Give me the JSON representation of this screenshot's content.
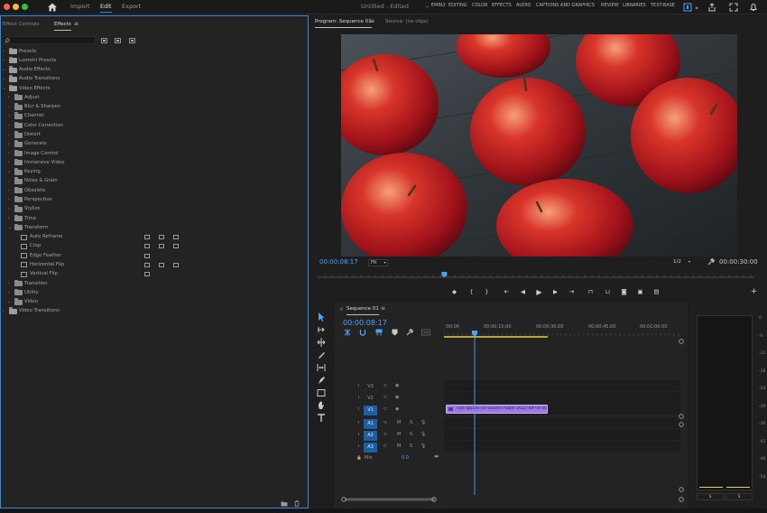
{
  "topbar": {
    "nav": [
      "Import",
      "Edit",
      "Export"
    ],
    "active_nav": "Edit",
    "document_title": "Untitled - Edited",
    "workspaces": [
      "EMBLY",
      "EDITING",
      "COLOR",
      "EFFECTS",
      "AUDIO",
      "CAPTIONS AND GRAPHICS",
      "REVIEW",
      "LIBRARIES",
      "TEXT-BASE"
    ]
  },
  "effects_panel": {
    "tabs": [
      "Effect Controls",
      "Effects"
    ],
    "active_tab": "Effects",
    "search_placeholder": "",
    "tree": [
      {
        "label": "Presets",
        "level": 0,
        "type": "special-folder"
      },
      {
        "label": "Lumetri Presets",
        "level": 0,
        "type": "special-folder"
      },
      {
        "label": "Audio Effects",
        "level": 0,
        "type": "special-folder"
      },
      {
        "label": "Audio Transitions",
        "level": 0,
        "type": "special-folder"
      },
      {
        "label": "Video Effects",
        "level": 0,
        "type": "special-folder",
        "expanded": true
      },
      {
        "label": "Adjust",
        "level": 1,
        "type": "folder"
      },
      {
        "label": "Blur & Sharpen",
        "level": 1,
        "type": "folder"
      },
      {
        "label": "Channel",
        "level": 1,
        "type": "folder"
      },
      {
        "label": "Color Correction",
        "level": 1,
        "type": "folder"
      },
      {
        "label": "Distort",
        "level": 1,
        "type": "folder"
      },
      {
        "label": "Generate",
        "level": 1,
        "type": "folder"
      },
      {
        "label": "Image Control",
        "level": 1,
        "type": "folder"
      },
      {
        "label": "Immersive Video",
        "level": 1,
        "type": "folder"
      },
      {
        "label": "Keying",
        "level": 1,
        "type": "folder"
      },
      {
        "label": "Noise & Grain",
        "level": 1,
        "type": "folder"
      },
      {
        "label": "Obsolete",
        "level": 1,
        "type": "folder"
      },
      {
        "label": "Perspective",
        "level": 1,
        "type": "folder"
      },
      {
        "label": "Stylize",
        "level": 1,
        "type": "folder"
      },
      {
        "label": "Time",
        "level": 1,
        "type": "folder"
      },
      {
        "label": "Transform",
        "level": 1,
        "type": "folder",
        "expanded": true
      },
      {
        "label": "Auto Reframe",
        "level": 2,
        "type": "effect",
        "badges": 3
      },
      {
        "label": "Crop",
        "level": 2,
        "type": "effect",
        "badges": 3
      },
      {
        "label": "Edge Feather",
        "level": 2,
        "type": "effect",
        "badges": 1
      },
      {
        "label": "Horizontal Flip",
        "level": 2,
        "type": "effect",
        "badges": 3
      },
      {
        "label": "Vertical Flip",
        "level": 2,
        "type": "effect",
        "badges": 1
      },
      {
        "label": "Transition",
        "level": 1,
        "type": "folder"
      },
      {
        "label": "Utility",
        "level": 1,
        "type": "folder"
      },
      {
        "label": "Video",
        "level": 1,
        "type": "folder"
      },
      {
        "label": "Video Transitions",
        "level": 0,
        "type": "special-folder"
      }
    ]
  },
  "program_monitor": {
    "tabs": [
      "Program: Sequence 01",
      "Source: (no clips)"
    ],
    "active_tab": "Program: Sequence 01",
    "timecode": "00:00:08:17",
    "fit": "Fit",
    "resolution": "1/2",
    "duration": "00:00:30:00",
    "playhead_fraction": 0.29
  },
  "timeline": {
    "tab": "Sequence 01",
    "timecode": "00:00:08:17",
    "ruler_labels": [
      ":00:00",
      "00:00:15:00",
      "00:00:30:00",
      "00:00:45:00",
      "00:01:00:00"
    ],
    "video_tracks": [
      "V3",
      "V2",
      "V1"
    ],
    "audio_tracks": [
      "A1",
      "A2",
      "A3"
    ],
    "mix_label": "Mix",
    "mix_value": "0.0",
    "clip_name": "ripe-apples-on-wooden-table-2022-08-04-00-...",
    "meter_labels": [
      "0",
      "-6",
      "-12",
      "-18",
      "-24",
      "-30",
      "-36",
      "-42",
      "-48",
      "-54"
    ],
    "meter_bottom": [
      "S",
      "S"
    ]
  },
  "colors": {
    "accent": "#2d8ceb",
    "timecode": "#4aa3ff",
    "clip": "#9f7ae6"
  }
}
